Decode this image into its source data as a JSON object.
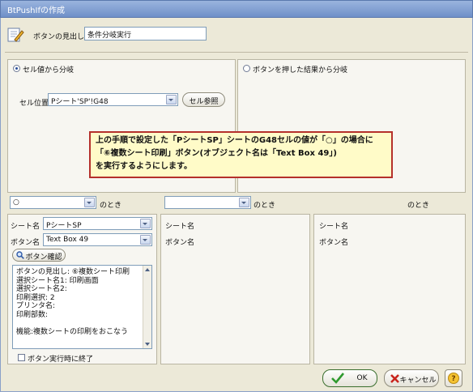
{
  "window": {
    "title": "BtPushIfの作成"
  },
  "header": {
    "label": "ボタンの見出し",
    "value": "条件分岐実行"
  },
  "branch": {
    "option_cell": "セル値から分岐",
    "option_button": "ボタンを押した結果から分岐",
    "cell_pos_label": "セル位置",
    "cell_pos_value": "Pシート'SP'!G48",
    "cell_ref_button": "セル参照"
  },
  "callout": {
    "line1": "上の手順で設定した「PシートSP」シートのG48セルの値が「○」の場合に",
    "line2": "「⑥複数シート印刷」ボタン(オブジェクト名は「Text Box 49」)",
    "line3": "を実行するようにします。"
  },
  "conditions": {
    "col1_value": "○",
    "when_label": "のとき",
    "col2_value": "",
    "col3_when": "のとき"
  },
  "detail": {
    "sheet_label": "シート名",
    "sheet_value": "PシートSP",
    "button_label": "ボタン名",
    "button_value": "Text Box 49",
    "confirm_button": "ボタン確認",
    "info_lines": [
      "ボタンの見出し: ⑥複数シート印刷",
      "選択シート名1: 印刷画面",
      "選択シート名2:",
      "印刷選択: 2",
      "プリンタ名:",
      "印刷部数:",
      "",
      "機能:複数シートの印刷をおこなう"
    ],
    "exit_checkbox": "ボタン実行時に終了"
  },
  "detail2": {
    "sheet_label": "シート名",
    "button_label": "ボタン名"
  },
  "detail3": {
    "sheet_label": "シート名",
    "button_label": "ボタン名"
  },
  "footer": {
    "ok": "OK",
    "cancel": "キャンセル",
    "help": "?"
  }
}
